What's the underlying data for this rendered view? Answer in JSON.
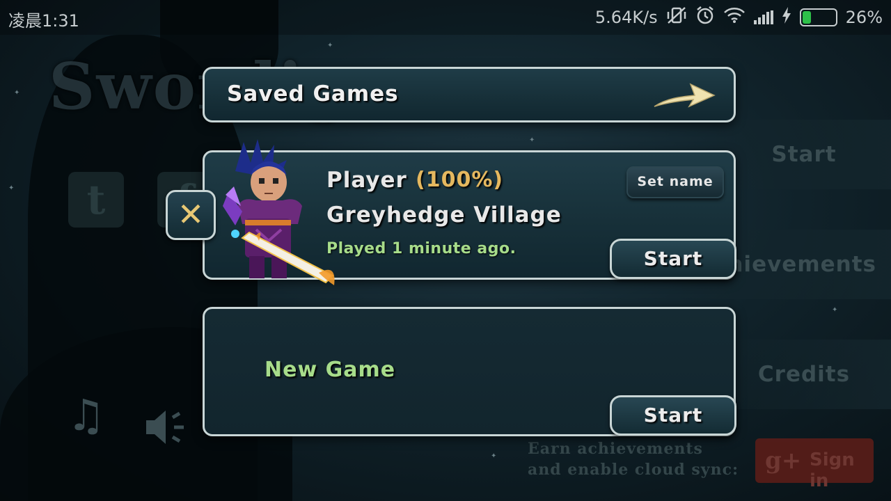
{
  "status_bar": {
    "time": "凌晨1:31",
    "network_speed": "5.64K/s",
    "battery_percent": "26%",
    "battery_level": 0.26,
    "icons": [
      "vibrate-off-icon",
      "alarm-icon",
      "wifi-icon",
      "signal-icon",
      "charging-icon",
      "battery-icon"
    ]
  },
  "background": {
    "logo_text": "Swordigo",
    "menu": {
      "start": "Start",
      "achievements": "Achievements",
      "credits": "Credits"
    },
    "earn_text_line1": "Earn achievements",
    "earn_text_line2": "and enable cloud sync:",
    "google_sign_in": "Sign in",
    "google_symbol": "g+",
    "social": [
      "twitter-icon",
      "facebook-icon"
    ],
    "audio_icons": [
      "music-note-icon",
      "speaker-icon"
    ]
  },
  "saved_games": {
    "title": "Saved Games",
    "back_icon": "arrow-right-icon"
  },
  "save_slot": {
    "player_name": "Player",
    "progress": "(100%)",
    "location": "Greyhedge Village",
    "played": "Played 1 minute ago.",
    "set_name_label": "Set name",
    "start_label": "Start",
    "delete_symbol": "✕"
  },
  "new_slot": {
    "label": "New Game",
    "start_label": "Start"
  },
  "colors": {
    "panel_border": "#c9d6d6",
    "accent_green": "#a7dc8a",
    "accent_gold": "#e5b85f",
    "delete_x": "#e8c874"
  }
}
